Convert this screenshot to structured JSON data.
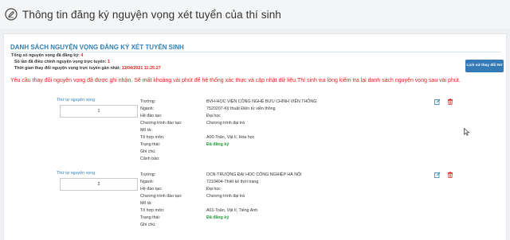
{
  "header": {
    "title": "Thông tin đăng ký nguyện vọng xét tuyển của thí sinh",
    "icon": "edit-note-icon"
  },
  "list": {
    "title": "DANH SÁCH NGUYỆN VỌNG ĐĂNG KÝ XÉT TUYỂN SINH",
    "history_button": "Lịch sử thay đổi NV",
    "notice": "Yêu cầu thay đổi nguyện vọng đã được ghi nhận. Sẽ mất khoảng vài phút để hệ thống xác thực và cập nhật dữ liệu.Thí sinh vui lòng kiểm tra lại danh sách nguyện vọng sau vài phút."
  },
  "stats": {
    "total_label": "Tổng số nguyện vọng đã đăng ký:",
    "total_value": "4",
    "changes_label": "Số lần đã điều chỉnh nguyện vọng trực tuyến:",
    "changes_value": "1",
    "last_time_label": "Thời gian thay đổi nguyện vọng trực tuyến gần nhất:",
    "last_time_value": "13/04/2021 11:25:27"
  },
  "labels": {
    "order": "Thứ tự nguyện vọng",
    "school": "Trường:",
    "major": "Ngành:",
    "level": "Hệ đào tạo:",
    "program": "Chương trình đào tạo:",
    "description": "Mô tả:",
    "combination": "Tổ hợp môn:",
    "status": "Trạng thái:",
    "note": "Ghi chú:",
    "warning": "Cảnh báo:"
  },
  "entries": [
    {
      "order": "1",
      "school": "BVH-HỌC VIỆN CÔNG NGHỆ BƯU CHÍNH VIỄN THÔNG",
      "major": "7520207-Kỹ thuật Điện tử viễn thông",
      "level": "Đại học",
      "program": "Chương trình đại trà",
      "description": "",
      "combination": "A00-Toán, Vật lí, Hóa học",
      "status": "Đã đăng ký",
      "note": "",
      "warning": ""
    },
    {
      "order": "2",
      "school": "DCN-TRƯỜNG ĐẠI HỌC CÔNG NGHIỆP HÀ NỘI",
      "major": "7210404-Thiết kế thời trang",
      "level": "Đại học",
      "program": "Chương trình đại trà",
      "description": "",
      "combination": "A01-Toán, Vật lí, Tiếng Anh",
      "status": "Đã đăng ký",
      "note": ""
    }
  ],
  "colors": {
    "accent": "#2f7fb5",
    "button": "#337ab7",
    "error": "#e0211b",
    "success": "#1f9d38"
  }
}
